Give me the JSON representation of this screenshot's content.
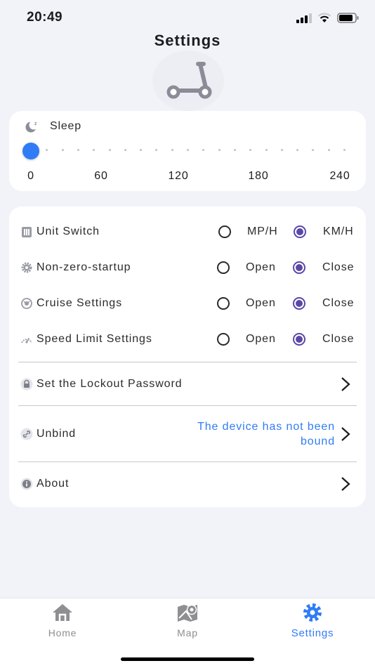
{
  "status_bar": {
    "time": "20:49"
  },
  "header": {
    "title": "Settings"
  },
  "sleep": {
    "label": "Sleep",
    "value": 0,
    "ticks": [
      "0",
      "60",
      "120",
      "180",
      "240"
    ]
  },
  "settings": {
    "unit_switch": {
      "label": "Unit Switch",
      "option_a": "MP/H",
      "option_b": "KM/H",
      "selected": "KM/H"
    },
    "non_zero_startup": {
      "label": "Non-zero-startup",
      "option_a": "Open",
      "option_b": "Close",
      "selected": "Close"
    },
    "cruise": {
      "label": "Cruise Settings",
      "option_a": "Open",
      "option_b": "Close",
      "selected": "Close"
    },
    "speed_limit": {
      "label": "Speed Limit Settings",
      "option_a": "Open",
      "option_b": "Close",
      "selected": "Close"
    },
    "lockout": {
      "label": "Set the Lockout Password"
    },
    "unbind": {
      "label": "Unbind",
      "status": "The device has not been bound"
    },
    "about": {
      "label": "About"
    }
  },
  "tabbar": {
    "tabs": [
      {
        "label": "Home",
        "icon": "home-icon"
      },
      {
        "label": "Map",
        "icon": "map-icon"
      },
      {
        "label": "Settings",
        "icon": "gear-icon",
        "active": true
      }
    ]
  },
  "colors": {
    "accent": "#2f7cf6",
    "radio_selected": "#5b47a8",
    "background": "#f1f3f9"
  }
}
